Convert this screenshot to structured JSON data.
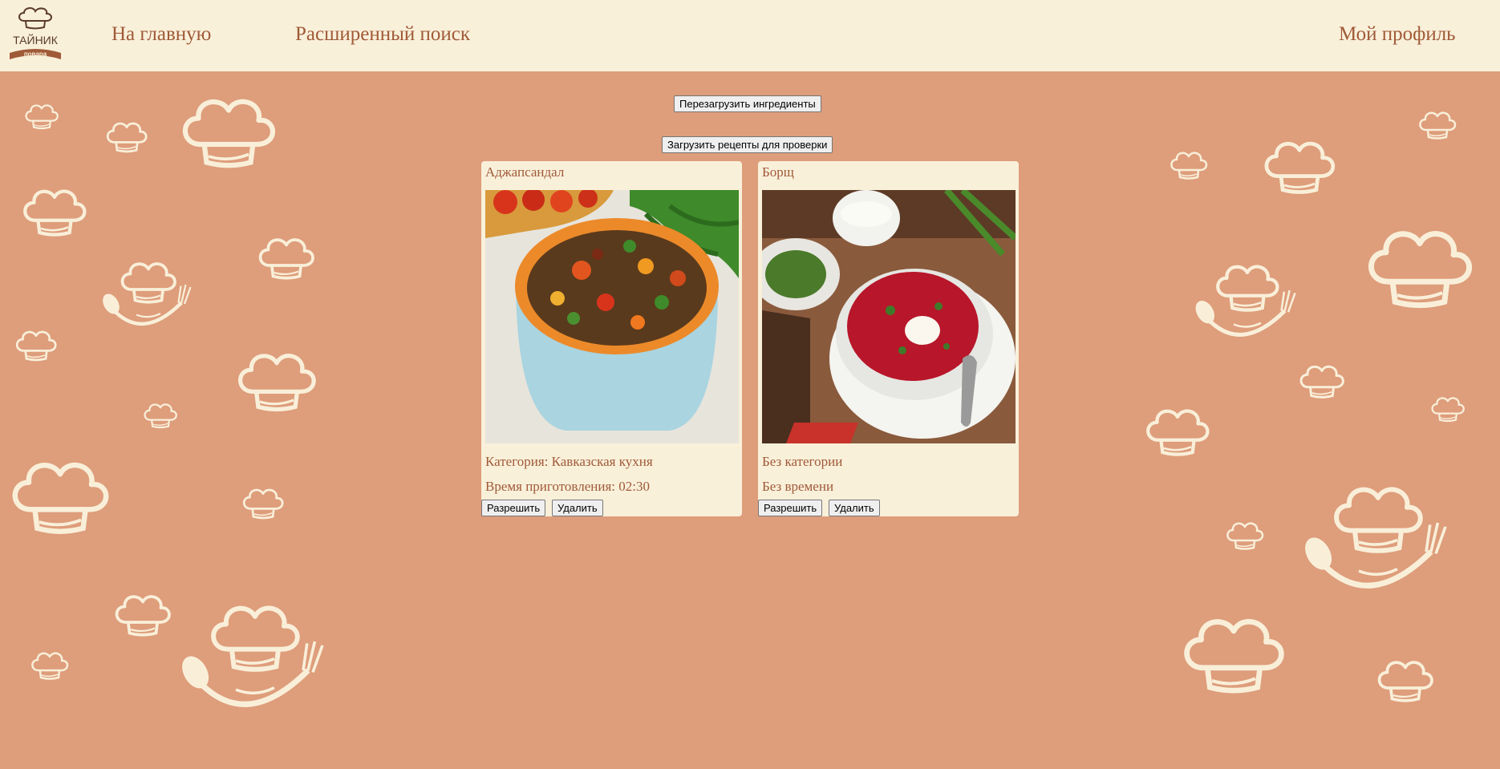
{
  "header": {
    "logo_text_top": "ТАЙНИК",
    "logo_text_ribbon": "повара",
    "nav": {
      "home": "На главную",
      "advanced_search": "Расширенный поиск",
      "profile": "Мой профиль"
    }
  },
  "actions": {
    "reload_ingredients": "Перезагрузить ингредиенты",
    "load_recipes": "Загрузить рецепты для проверки"
  },
  "recipes": [
    {
      "title": "Аджапсандал",
      "image_icon": "vegetable-stew-photo",
      "category": "Категория: Кавказская кухня",
      "time": "Время приготовления: 02:30",
      "approve": "Разрешить",
      "delete": "Удалить"
    },
    {
      "title": "Борщ",
      "image_icon": "borscht-photo",
      "category": "Без категории",
      "time": "Без времени",
      "approve": "Разрешить",
      "delete": "Удалить"
    }
  ],
  "colors": {
    "background": "#de9d7b",
    "header_bg": "#f9f0da",
    "accent_text": "#a05a38",
    "pattern": "#f9efd9"
  }
}
